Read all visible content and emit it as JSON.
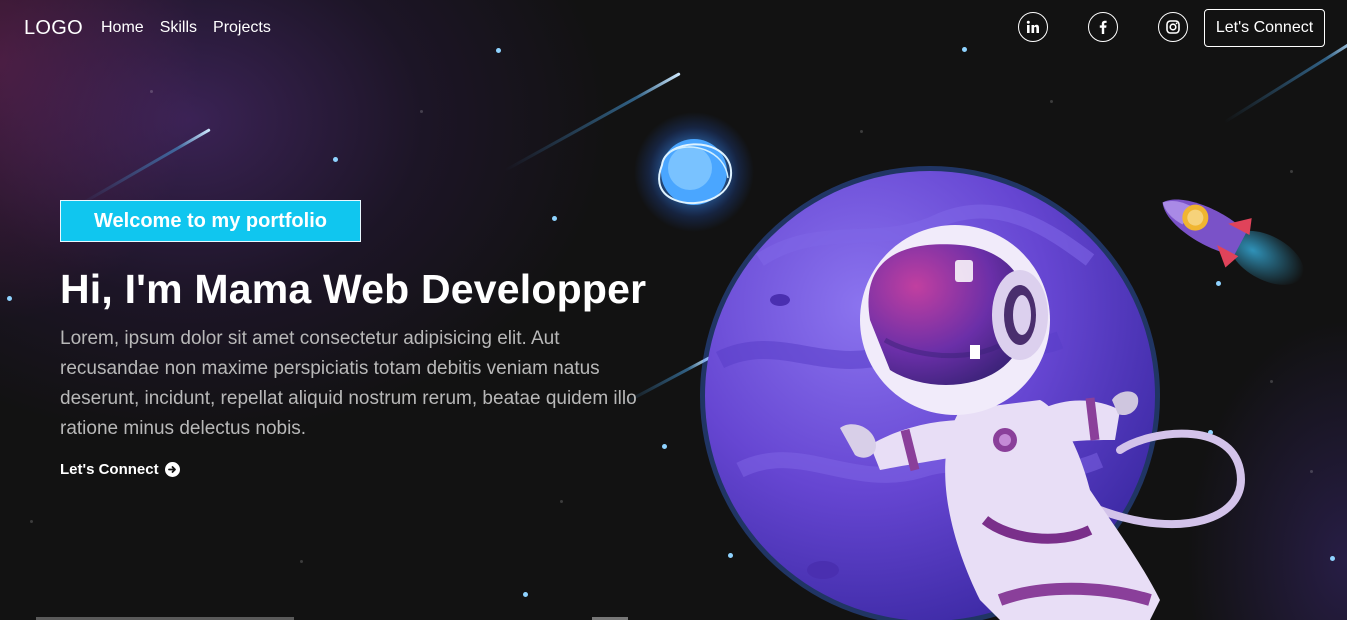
{
  "navbar": {
    "logo": "LOGO",
    "links": [
      {
        "label": "Home"
      },
      {
        "label": "Skills"
      },
      {
        "label": "Projects"
      }
    ],
    "social_icons": [
      "linkedin-icon",
      "facebook-icon",
      "instagram-icon"
    ],
    "connect_label": "Let's Connect"
  },
  "banner": {
    "tagline": "Welcome to my portfolio",
    "headline": "Hi, I'm Mama Web Developper",
    "intro": "Lorem, ipsum dolor sit amet consectetur adipisicing elit. Aut recusandae non maxime perspiciatis totam debitis veniam natus deserunt, incidunt, repellat aliquid nostrum rerum, beatae quidem illo ratione minus delectus nobis.",
    "cta_label": "Let's Connect",
    "cta_icon": "arrow-right-circle-icon"
  },
  "illustration": {
    "subjects": [
      "astronaut",
      "purple-planet",
      "glowing-blue-orb",
      "rocket",
      "shooting-stars"
    ]
  },
  "colors": {
    "background": "#121212",
    "tagline_bg": "#10c6ef",
    "text_primary": "#ffffff",
    "text_secondary": "#b8b8b8",
    "planet": "#6f50d8",
    "star": "#8fd3ff"
  }
}
